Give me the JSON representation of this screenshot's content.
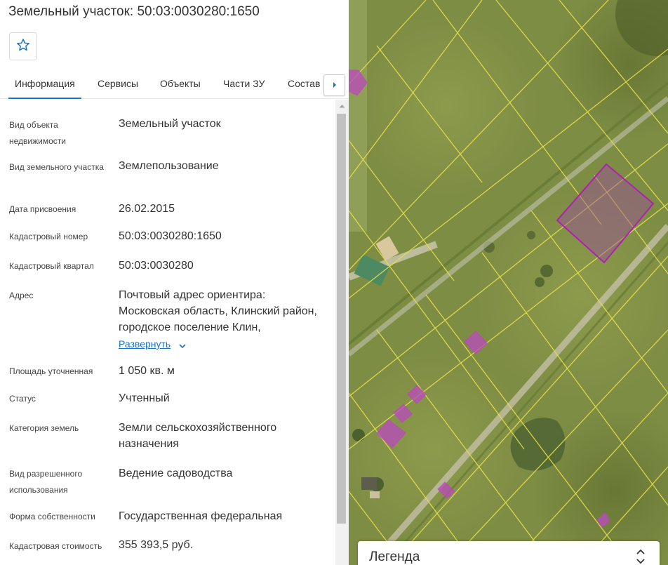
{
  "panel": {
    "title": "Земельный участок: 50:03:0030280:1650",
    "favorite_icon": "star-outline-icon",
    "tabs": [
      {
        "label": "Информация",
        "active": true
      },
      {
        "label": "Сервисы"
      },
      {
        "label": "Объекты"
      },
      {
        "label": "Части ЗУ"
      },
      {
        "label": "Состав"
      }
    ],
    "tab_next_icon": "caret-right-icon",
    "accent_color": "#1a73c8",
    "fields": [
      {
        "label": "Вид объекта недвижимости",
        "value": "Земельный участок"
      },
      {
        "label": "Вид земельного участка",
        "value": "Землепользование"
      },
      {
        "label": "Дата присвоения",
        "value": "26.02.2015"
      },
      {
        "label": "Кадастровый номер",
        "value": "50:03:0030280:1650"
      },
      {
        "label": "Кадастровый квартал",
        "value": "50:03:0030280"
      },
      {
        "label": "Адрес",
        "value": "Почтовый адрес ориентира: Московская область, Клинский район, городское поселение Клин,",
        "expand_label": "Развернуть"
      },
      {
        "label": "Площадь уточненная",
        "value": "1 050 кв. м"
      },
      {
        "label": "Статус",
        "value": "Учтенный"
      },
      {
        "label": "Категория земель",
        "value": "Земли сельскохозяйственного назначения"
      },
      {
        "label": "Вид разрешенного использования",
        "value": "Ведение садоводства"
      },
      {
        "label": "Форма собственности",
        "value": "Государственная федеральная"
      },
      {
        "label": "Кадастровая стоимость",
        "value": "355 393,5 руб."
      }
    ]
  },
  "map": {
    "parcel_line_color": "#e6e04a",
    "selected_parcel_color": "#b020b0",
    "legend": {
      "title": "Легенда",
      "icon": "chevron-up-down-icon"
    }
  }
}
